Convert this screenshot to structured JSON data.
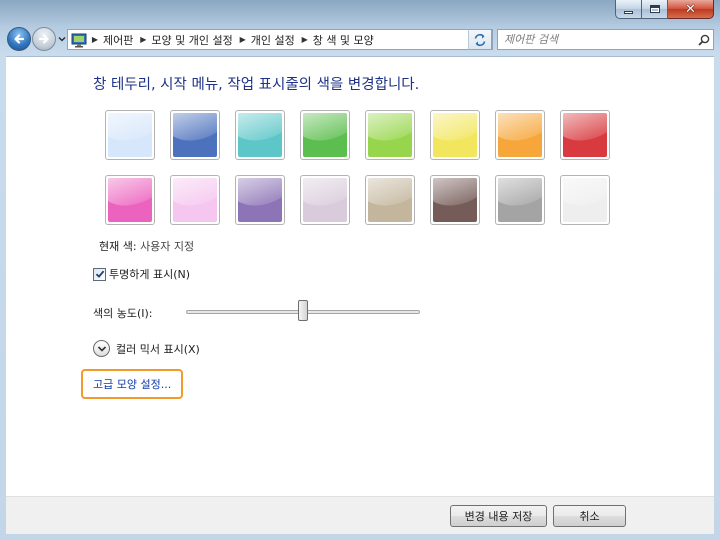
{
  "nav": {
    "breadcrumbs": [
      "제어판",
      "모양 및 개인 설정",
      "개인 설정",
      "창 색 및 모양"
    ],
    "search_placeholder": "제어판 검색"
  },
  "main": {
    "heading": "창 테두리, 시작 메뉴, 작업 표시줄의 색을 변경합니다.",
    "swatches": [
      {
        "color": "#d6e6fb"
      },
      {
        "color": "#4d72bd"
      },
      {
        "color": "#5cc6c8"
      },
      {
        "color": "#5cbe4e"
      },
      {
        "color": "#97d64c"
      },
      {
        "color": "#f2e65e"
      },
      {
        "color": "#f6a63a"
      },
      {
        "color": "#d83a3f"
      },
      {
        "color": "#ec63bf"
      },
      {
        "color": "#f5c6ef"
      },
      {
        "color": "#8d74b6"
      },
      {
        "color": "#d9cbdc"
      },
      {
        "color": "#c3b69d"
      },
      {
        "color": "#765c58"
      },
      {
        "color": "#a4a4a4"
      },
      {
        "color": "#eeeeee"
      }
    ],
    "current_color_label": "현재 색:",
    "current_color_value": "사용자 지정",
    "transparency_label": "투명하게 표시(N)",
    "transparency_checked": true,
    "intensity_label": "색의 농도(I):",
    "intensity_value": 0.5,
    "mixer_label": "컬러 믹서 표시(X)",
    "advanced_link": "고급 모양 설정..."
  },
  "footer": {
    "save_label": "변경 내용 저장",
    "cancel_label": "취소"
  }
}
